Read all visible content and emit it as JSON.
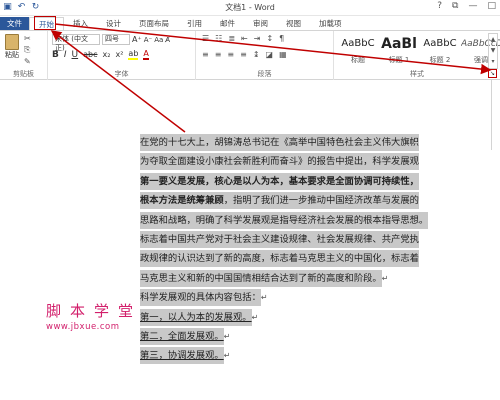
{
  "window": {
    "title": "文档1 - Word",
    "qat_icons": [
      "save-icon",
      "undo-icon",
      "redo-icon"
    ],
    "controls": [
      "?",
      "⧉",
      "—",
      "□"
    ]
  },
  "tabs": {
    "file": "文件",
    "home": "开始",
    "insert": "插入",
    "design": "设计",
    "layout": "页面布局",
    "references": "引用",
    "mailings": "邮件",
    "review": "审阅",
    "view": "视图",
    "addins": "加载项"
  },
  "ribbon": {
    "clipboard": {
      "paste": "粘贴",
      "label": "剪贴板"
    },
    "font": {
      "name": "宋体 (中文正)",
      "size": "四号",
      "label": "字体"
    },
    "paragraph": {
      "label": "段落"
    },
    "styles": {
      "label": "样式",
      "items": [
        {
          "sample": "AaBbC",
          "name": "标题"
        },
        {
          "sample": "AaBl",
          "name": "标题 1"
        },
        {
          "sample": "AaBbC",
          "name": "标题 2"
        },
        {
          "sample": "AaBbCcDı",
          "name": "强调"
        }
      ]
    }
  },
  "document": {
    "lines": [
      "在党的十七大上，胡锦涛总书记在《高举中国特色社会主义伟大旗帜",
      "为夺取全面建设小康社会新胜利而奋斗》的报告中提出，科学发展观",
      "第一要义是发展，核心是以人为本，基本要求是全面协调可持续性，",
      "根本方法是统筹兼顾",
      "，指明了我们进一步推动中国经济改革与发展的",
      "思路和战略，明确了科学发展观是指导经济社会发展的根本指导思想。",
      "标志着中国共产党对于社会主义建设规律、社会发展规律、共产党执",
      "政规律的认识达到了新的高度，标志着马克思主义的中国化，标志着",
      "马克思主义和新的中国国情相结合达到了新的高度和阶段。",
      "科学发展观的具体内容包括：",
      "第一，以人为本的发展观。",
      "第二，全面发展观。",
      "第三，协调发展观。"
    ],
    "mark": "↵"
  },
  "watermark": {
    "cn": "脚本学堂",
    "url": "www.jbxue.com"
  },
  "colors": {
    "accent": "#2b579a",
    "annotation": "#c00000",
    "highlight": "#c8c8c8",
    "watermark": "#d21f6b"
  }
}
